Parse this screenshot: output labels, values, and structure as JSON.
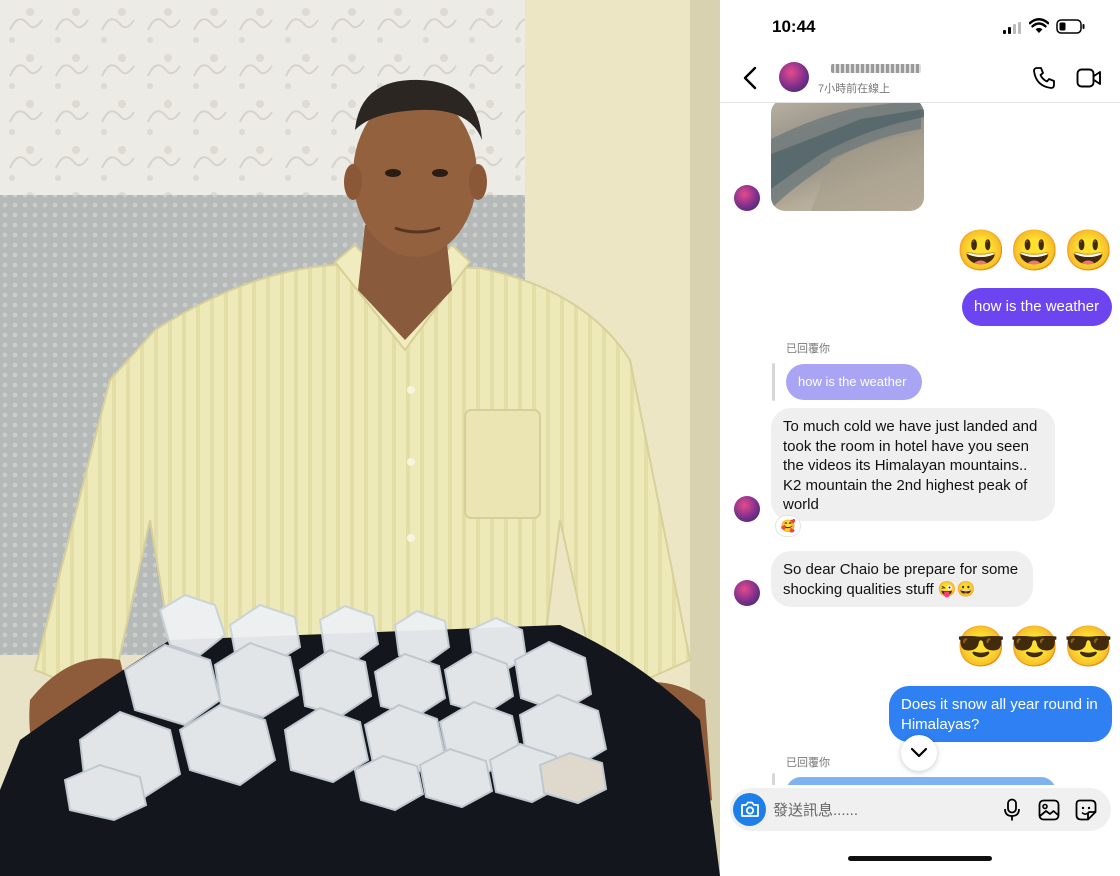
{
  "status_bar": {
    "time": "10:44"
  },
  "chat_header": {
    "online_status": "7小時前在線上"
  },
  "messages": {
    "outgoing_emoji_1": "😃😃😃",
    "outgoing_1": "how is the weather",
    "reply_label_1": "已回覆你",
    "quoted_1": "how is the weather",
    "incoming_1": "To much cold we have just landed and took the room in hotel have you seen the videos its Himalayan mountains.. K2 mountain the 2nd highest peak of world",
    "reaction_1": "🥰",
    "incoming_2": "So dear Chaio be prepare for some shocking qualities stuff 😜😀",
    "outgoing_emoji_2": "😎😎😎",
    "outgoing_2": "Does it snow all year round in Himalayas?",
    "reply_label_2": "已回覆你"
  },
  "composer": {
    "placeholder": "發送訊息......"
  },
  "colors": {
    "outgoing_purple": "#6c45f0",
    "outgoing_blue": "#2f80f2",
    "quoted_bubble": "#a9a4f4",
    "incoming_bubble": "#efefef",
    "camera_button": "#1f7fe8"
  },
  "icons": [
    "back-icon",
    "phone-icon",
    "video-icon",
    "camera-icon",
    "mic-icon",
    "gallery-icon",
    "sticker-icon",
    "chevron-down-icon",
    "signal-icon",
    "wifi-icon",
    "battery-icon"
  ]
}
